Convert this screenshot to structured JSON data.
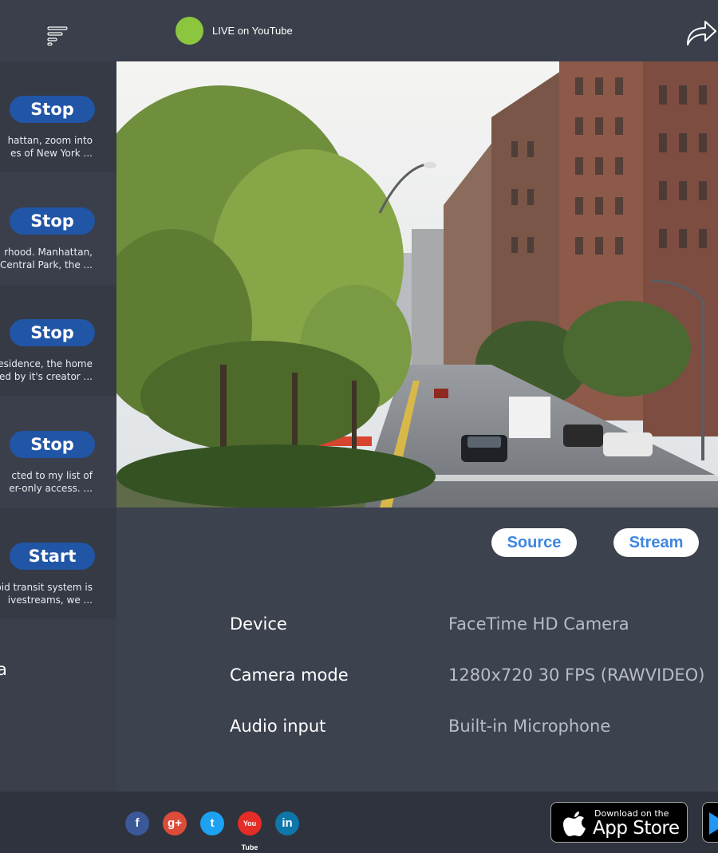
{
  "header": {
    "live_status": "LIVE on YouTube",
    "live_color": "#8cc63f"
  },
  "sidebar": {
    "items": [
      {
        "button": "Stop",
        "line1": "hattan, zoom into",
        "line2": "es of New York ..."
      },
      {
        "button": "Stop",
        "line1": "rhood. Manhattan,",
        "line2": "Central Park, the ..."
      },
      {
        "button": "Stop",
        "line1": "esidence, the home",
        "line2": "ed by it's creator ..."
      },
      {
        "button": "Stop",
        "line1": "cted to my list of",
        "line2": "er-only access. ..."
      },
      {
        "button": "Start",
        "line1": "pid transit system is",
        "line2": "ivestreams, we ..."
      }
    ],
    "partial_text": "a"
  },
  "main": {
    "source_label": "Source",
    "stream_label": "Stream",
    "settings": [
      {
        "label": "Device",
        "value": "FaceTime HD Camera"
      },
      {
        "label": "Camera mode",
        "value": "1280x720 30 FPS (RAWVIDEO)"
      },
      {
        "label": "Audio input",
        "value": "Built-in Microphone"
      }
    ]
  },
  "footer": {
    "social": [
      "facebook-icon",
      "google-plus-icon",
      "twitter-icon",
      "youtube-icon",
      "linkedin-icon"
    ],
    "facebook_glyph": "f",
    "google_glyph": "g+",
    "twitter_glyph": "t",
    "youtube_glyph": "You Tube",
    "linkedin_glyph": "in",
    "appstore_small": "Download on the",
    "appstore_big": "App Store"
  },
  "colors": {
    "accent_button": "#2155a6",
    "pill_text": "#3e86e0",
    "background": "#3a3f4b"
  }
}
